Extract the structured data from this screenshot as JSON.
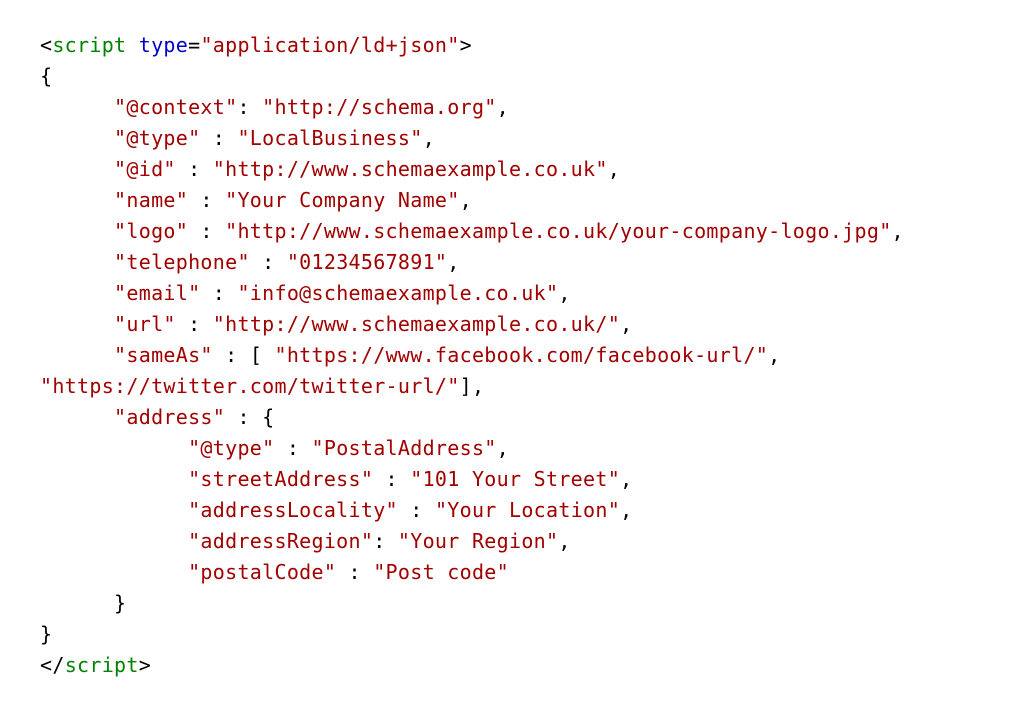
{
  "code": {
    "open_bracket": "<",
    "close_bracket": ">",
    "slash": "/",
    "tag_script": "script",
    "attr_type": "type",
    "attr_equals": "=",
    "attr_type_value": "\"application/ld+json\"",
    "brace_open": "{",
    "brace_close": "}",
    "indent1": "      ",
    "indent2": "            ",
    "k_context": "\"@context\"",
    "colon": ":",
    "colon_sp": " :",
    "comma": ",",
    "v_context": "\"http://schema.org\"",
    "k_type": "\"@type\"",
    "v_type": "\"LocalBusiness\"",
    "k_id": "\"@id\"",
    "v_id": "\"http://www.schemaexample.co.uk\"",
    "k_name": "\"name\"",
    "v_name": "\"Your Company Name\"",
    "k_logo": "\"logo\"",
    "v_logo": "\"http://www.schemaexample.co.uk/your-company-logo.jpg\"",
    "k_telephone": "\"telephone\"",
    "v_telephone": "\"01234567891\"",
    "k_email": "\"email\"",
    "v_email": "\"info@schemaexample.co.uk\"",
    "k_url": "\"url\"",
    "v_url": "\"http://www.schemaexample.co.uk/\"",
    "k_sameas": "\"sameAs\"",
    "sameas_open": "[ ",
    "sameas_close": "]",
    "v_sameas1": "\"https://www.facebook.com/facebook-url/\"",
    "v_sameas2": "\"https://twitter.com/twitter-url/\"",
    "k_address": "\"address\"",
    "k_addr_type": "\"@type\"",
    "v_addr_type": "\"PostalAddress\"",
    "k_street": "\"streetAddress\"",
    "v_street": "\"101 Your Street\"",
    "k_locality": "\"addressLocality\"",
    "v_locality": "\"Your Location\"",
    "k_region": "\"addressRegion\"",
    "v_region": "\"Your Region\"",
    "k_postal": "\"postalCode\"",
    "v_postal": "\"Post code\""
  }
}
